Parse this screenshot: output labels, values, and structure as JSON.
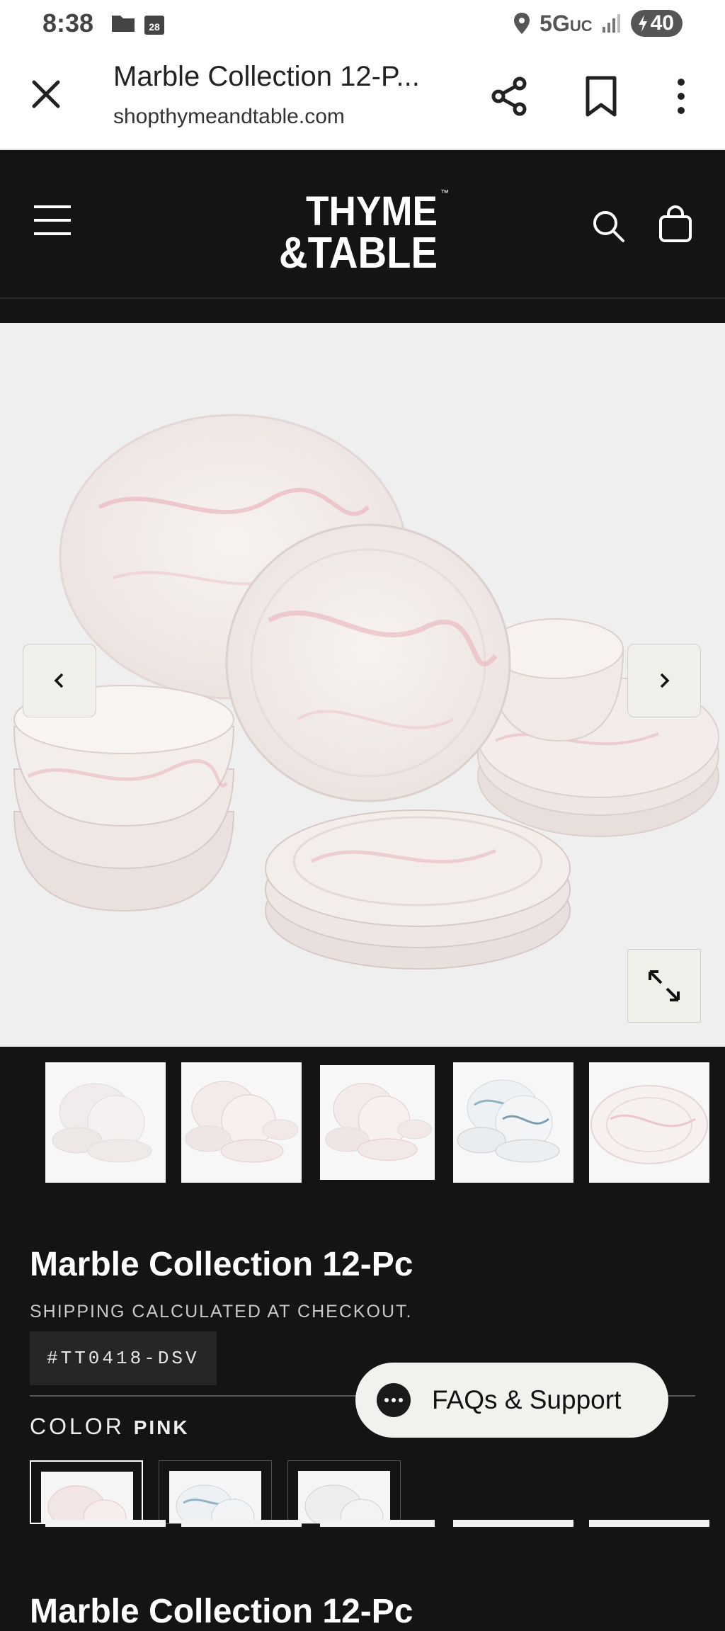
{
  "status_bar": {
    "time": "8:38",
    "calendar_day": "28",
    "network": "5G",
    "network_suffix": "UC",
    "battery": "40"
  },
  "custom_tab": {
    "title": "Marble Collection 12-P...",
    "url": "shopthymeandtable.com"
  },
  "site_header": {
    "logo_line1": "THYME",
    "logo_line2": "&TABLE",
    "logo_tm": "™"
  },
  "product": {
    "name": "Marble Collection 12-Pc",
    "shipping_note": "SHIPPING CALCULATED AT CHECKOUT.",
    "sku": "#TT0418-DSV",
    "color_label": "COLOR",
    "color_value": "PINK"
  },
  "faq": {
    "label": "FAQs & Support"
  },
  "thumbnails": [
    "pink-12pc-set",
    "pink-set-angle",
    "pink-set-front",
    "blue-marble-set",
    "single-plate"
  ],
  "swatches": [
    "pink",
    "blue",
    "grey"
  ],
  "colors": {
    "background": "#141414",
    "accent_pink": "#e9b7bd",
    "accent_blue": "#8fb3c9"
  }
}
